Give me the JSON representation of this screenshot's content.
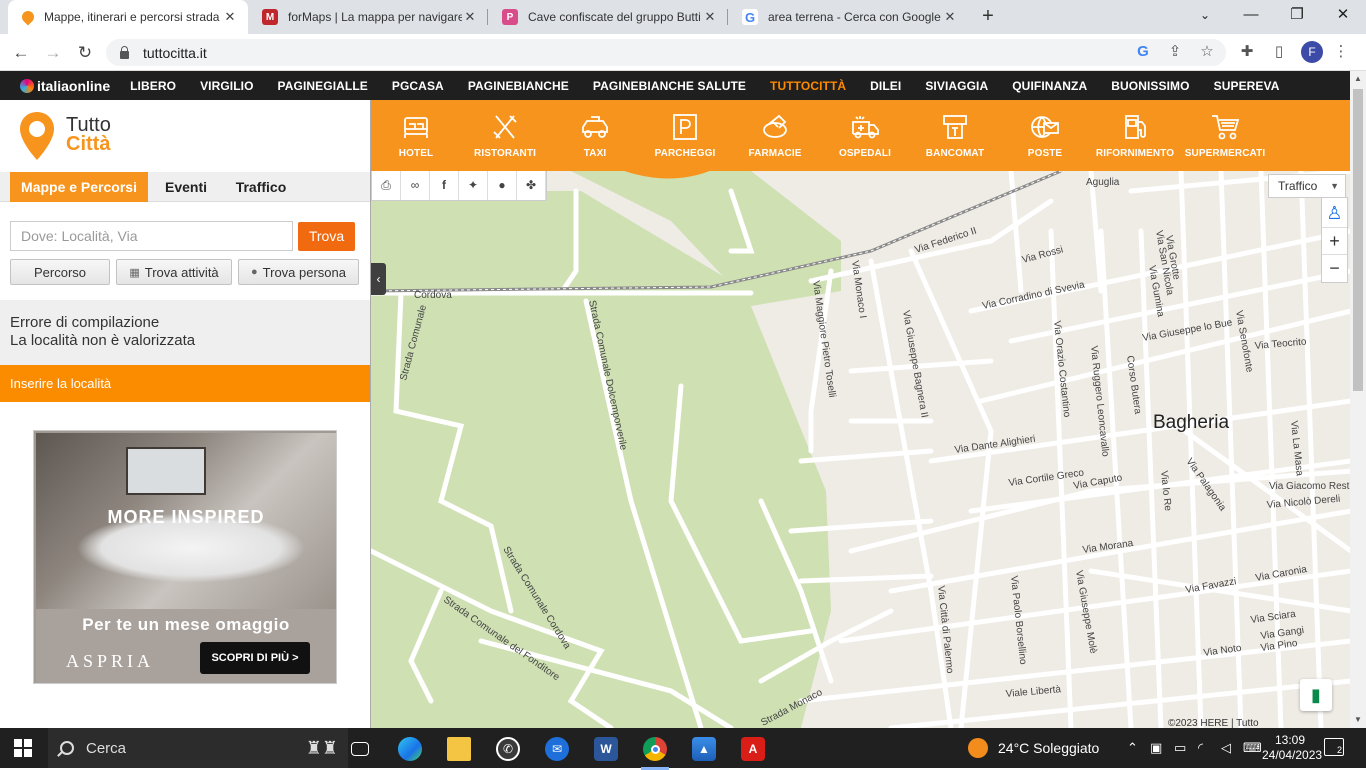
{
  "browser": {
    "tabs": [
      {
        "title": "Mappe, itinerari e percorsi strada",
        "icon": "tuttocitta-pin-icon",
        "color": "#f7941d"
      },
      {
        "title": "forMaps | La mappa per navigare",
        "icon": "formaps-icon",
        "color": "#c0272d"
      },
      {
        "title": "Cave confiscate del gruppo Butti",
        "icon": "p-icon",
        "color": "#d94c8a"
      },
      {
        "title": "area terrena - Cerca con Google",
        "icon": "google-icon",
        "color": "#4285f4"
      }
    ],
    "url": "tuttocitta.it",
    "profile_initial": "F"
  },
  "topnav": {
    "logo": "italiaonline",
    "links": [
      "LIBERO",
      "VIRGILIO",
      "PAGINEGIALLE",
      "PGCASA",
      "PAGINEBIANCHE",
      "PAGINEBIANCHE SALUTE",
      "TUTTOCITTÀ",
      "DILEI",
      "SIVIAGGIA",
      "QUIFINANZA",
      "BUONISSIMO",
      "SUPEREVA"
    ],
    "highlight_index": 6,
    "highlight_color": "#ff8a00"
  },
  "brand": {
    "line1": "Tutto",
    "line2": "Città",
    "accent": "#f7941d"
  },
  "panel_tabs": [
    "Mappe e Percorsi",
    "Eventi",
    "Traffico"
  ],
  "search": {
    "placeholder": "Dove: Località, Via",
    "find_label": "Trova",
    "route_label": "Percorso",
    "find_business_label": "Trova attività",
    "find_person_label": "Trova persona"
  },
  "error": {
    "title": "Errore di compilazione",
    "message": "La località non è valorizzata",
    "prompt": "Inserire la località"
  },
  "ad": {
    "headline": "MORE INSPIRED",
    "offer": "Per te un mese omaggio",
    "brand": "ASPRIA",
    "cta": "SCOPRI DI PIÙ >"
  },
  "categories": [
    "HOTEL",
    "RISTORANTI",
    "TAXI",
    "PARCHEGGI",
    "FARMACIE",
    "OSPEDALI",
    "BANCOMAT",
    "POSTE",
    "RIFORNIMENTO",
    "SUPERMERCATI"
  ],
  "map": {
    "traffic_label": "Traffico",
    "city": "Bagheria",
    "labels": {
      "aguglia": "Aguglia",
      "cordova": "Cordova",
      "strada_comunale": "Strada Comunale",
      "dolcemporverile": "Strada Comunale Dolcemporverile",
      "sc_cordova": "Strada Comunale Cordova",
      "fonditore": "Strada Comunale del Fonditore",
      "monaco": "Strada Monaco",
      "federico": "Via Federico II",
      "rossi": "Via Rossi",
      "corradino": "Via Corradino di Svevia",
      "monaco1": "Via Monaco I",
      "toselli": "Via Maggiore Pietro Toselli",
      "bagnera": "Via Giuseppe Bagnera II",
      "costantino": "Via Orazio Costantino",
      "leoncavallo": "Via Ruggero Leoncavallo",
      "corso_butera": "Corso Butera",
      "lobue": "Via Giuseppe lo Bue",
      "teocrito": "Via Teocrito",
      "dante": "Via Dante Alighieri",
      "cortile": "Via Cortile Greco",
      "caputo": "Via Caputo",
      "palagonia": "Via Palagonia",
      "giacomo": "Via Giacomo Rest",
      "dereli": "Via Nicolò Dereli",
      "morana": "Via Morana",
      "favazzi": "Via Favazzi",
      "caronia": "Via Caronia",
      "sciara": "Via Sciara",
      "gangi": "Via Gangi",
      "pino": "Via Pino",
      "noto": "Via Noto",
      "liberta": "Viale Libertà",
      "palermo": "Via Città di Palermo",
      "borsellino": "Via Paolo Borsellino",
      "mole": "Via Giuseppe Molè",
      "sannicola": "Via San Nicola",
      "grotte": "Via Grotte",
      "gumina": "Via Gumina",
      "senofonte": "Via Senofonte",
      "masa": "Via La Masa",
      "lore": "Via lo Re",
      "copyright": "©2023 HERE |",
      "tutto": "Tutto"
    }
  },
  "taskbar": {
    "search_label": "Cerca",
    "weather": "24°C  Soleggiato",
    "time": "13:09",
    "date": "24/04/2023",
    "notifications": "2"
  }
}
